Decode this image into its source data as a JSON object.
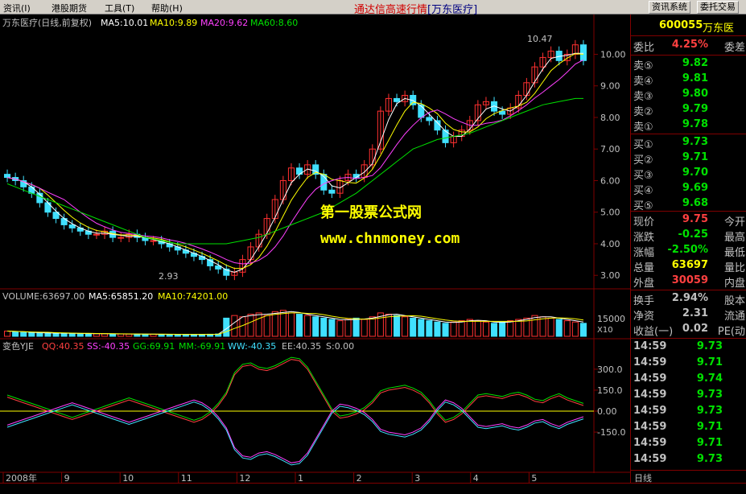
{
  "menu": {
    "items": [
      "资讯(I)",
      "港股期货",
      "工具(T)",
      "帮助(H)"
    ],
    "center_title": "通达信高速行情",
    "center_stock": "[万东医疗]",
    "buttons": [
      "资讯系统",
      "委托交易"
    ]
  },
  "main_header": {
    "title": "万东医疗(日线,前复权)",
    "ma5": "MA5:10.01",
    "ma10": "MA10:9.89",
    "ma20": "MA20:9.62",
    "ma60": "MA60:8.60"
  },
  "annotations": {
    "high_label": "10.47",
    "low_label": "2.93"
  },
  "volume_header": {
    "volume": "VOLUME:63697.00",
    "ma5": "MA5:65851.20",
    "ma10": "MA10:74201.00"
  },
  "indicator_header": {
    "name": "变色YJE",
    "qq": "QQ:40.35",
    "ss": "SS:-40.35",
    "gg": "GG:69.91",
    "mm": "MM:-69.91",
    "ww": "WW:-40.35",
    "ee": "EE:40.35",
    "s": "S:0.00"
  },
  "axes": {
    "price_ticks": [
      "10.00",
      "9.00",
      "8.00",
      "7.00",
      "6.00",
      "5.00",
      "4.00",
      "3.00"
    ],
    "volume_tick": "15000",
    "volume_unit": "X10",
    "indicator_ticks": [
      "300.0",
      "150.0",
      "0.00",
      "-150.0"
    ],
    "dates": [
      "2008年",
      "9",
      "10",
      "11",
      "12",
      "1",
      "2",
      "3",
      "4",
      "5"
    ]
  },
  "watermark": {
    "line1": "第一股票公式网",
    "line2": "www.chnmoney.com"
  },
  "quote": {
    "code": "600055",
    "name": "万东医",
    "weibi_label": "委比",
    "weibi": "4.25%",
    "weicha_label": "委差",
    "sell": [
      {
        "label": "卖⑤",
        "price": "9.82"
      },
      {
        "label": "卖④",
        "price": "9.81"
      },
      {
        "label": "卖③",
        "price": "9.80"
      },
      {
        "label": "卖②",
        "price": "9.79"
      },
      {
        "label": "卖①",
        "price": "9.78"
      }
    ],
    "buy": [
      {
        "label": "买①",
        "price": "9.73"
      },
      {
        "label": "买②",
        "price": "9.71"
      },
      {
        "label": "买③",
        "price": "9.70"
      },
      {
        "label": "买④",
        "price": "9.69"
      },
      {
        "label": "买⑤",
        "price": "9.68"
      }
    ],
    "stats": [
      {
        "label": "现价",
        "value": "9.75",
        "label2": "今开",
        "color": "#ff4040"
      },
      {
        "label": "涨跌",
        "value": "-0.25",
        "label2": "最高",
        "color": "#00e000"
      },
      {
        "label": "涨幅",
        "value": "-2.50%",
        "label2": "最低",
        "color": "#00e000"
      },
      {
        "label": "总量",
        "value": "63697",
        "label2": "量比",
        "color": "#ffff00"
      },
      {
        "label": "外盘",
        "value": "30059",
        "label2": "内盘",
        "color": "#ff4040"
      }
    ],
    "stats2": [
      {
        "label": "换手",
        "value": "2.94%",
        "label2": "股本",
        "color": "#c0c0c0"
      },
      {
        "label": "净资",
        "value": "2.31",
        "label2": "流通",
        "color": "#c0c0c0"
      },
      {
        "label": "收益(一)",
        "value": "0.02",
        "label2": "PE(动",
        "color": "#c0c0c0"
      }
    ],
    "ticks": [
      {
        "time": "14:59",
        "price": "9.73"
      },
      {
        "time": "14:59",
        "price": "9.71"
      },
      {
        "time": "14:59",
        "price": "9.74"
      },
      {
        "time": "14:59",
        "price": "9.73"
      },
      {
        "time": "14:59",
        "price": "9.73"
      },
      {
        "time": "14:59",
        "price": "9.71"
      },
      {
        "time": "14:59",
        "price": "9.71"
      },
      {
        "time": "14:59",
        "price": "9.73"
      }
    ],
    "bottom_tab": "日线"
  },
  "chart_data": {
    "type": "candlestick",
    "price_ylim": [
      2.7,
      10.7
    ],
    "close": [
      6.1,
      6.0,
      5.8,
      5.6,
      5.3,
      5.0,
      4.8,
      4.6,
      4.5,
      4.4,
      4.3,
      4.3,
      4.4,
      4.2,
      4.2,
      4.3,
      4.2,
      4.1,
      4.1,
      4.0,
      3.9,
      3.8,
      3.7,
      3.6,
      3.5,
      3.3,
      3.2,
      3.0,
      3.1,
      3.5,
      3.9,
      4.3,
      4.8,
      5.4,
      6.0,
      6.4,
      6.2,
      6.5,
      6.2,
      5.7,
      5.6,
      6.0,
      6.2,
      6.1,
      6.5,
      7.0,
      8.2,
      8.6,
      8.5,
      8.7,
      8.4,
      8.0,
      7.9,
      7.6,
      7.2,
      7.4,
      7.6,
      7.9,
      8.4,
      8.5,
      8.2,
      8.1,
      8.3,
      8.7,
      9.1,
      9.6,
      9.9,
      10.1,
      9.8,
      10.0,
      10.3,
      9.8
    ],
    "ma60": [
      5.9,
      5.8,
      5.7,
      5.6,
      5.5,
      5.4,
      5.3,
      5.2,
      5.1,
      5.0,
      4.9,
      4.8,
      4.7,
      4.6,
      4.5,
      4.4,
      4.3,
      4.2,
      4.15,
      4.1,
      4.05,
      4.0,
      4.0,
      4.0,
      4.0,
      4.0,
      4.0,
      4.0,
      4.05,
      4.1,
      4.15,
      4.2,
      4.3,
      4.4,
      4.5,
      4.6,
      4.7,
      4.8,
      4.9,
      5.0,
      5.15,
      5.3,
      5.45,
      5.6,
      5.8,
      6.0,
      6.2,
      6.4,
      6.6,
      6.8,
      7.0,
      7.1,
      7.2,
      7.3,
      7.35,
      7.4,
      7.45,
      7.5,
      7.6,
      7.7,
      7.8,
      7.9,
      8.0,
      8.1,
      8.2,
      8.3,
      8.4,
      8.45,
      8.5,
      8.55,
      8.6,
      8.6
    ],
    "volume_ylim": [
      0,
      26000
    ],
    "volume": [
      4000,
      3500,
      3000,
      2800,
      2500,
      2600,
      2400,
      2300,
      2200,
      2100,
      2000,
      2000,
      1900,
      1800,
      1800,
      1700,
      1700,
      1600,
      1600,
      1500,
      1500,
      1500,
      1400,
      1400,
      1500,
      1600,
      1800,
      14000,
      16000,
      15000,
      17000,
      18000,
      16000,
      19000,
      20000,
      18000,
      17000,
      16000,
      15000,
      14000,
      13000,
      12000,
      13000,
      14000,
      13000,
      15000,
      18000,
      17000,
      16000,
      15000,
      14000,
      13000,
      12000,
      11000,
      10000,
      11000,
      12000,
      13000,
      12000,
      11000,
      10000,
      11000,
      12000,
      13000,
      14000,
      16000,
      15000,
      14000,
      13000,
      12000,
      11000,
      10000
    ],
    "indicator_ylim": [
      -420,
      420
    ],
    "qq": [
      100,
      80,
      60,
      40,
      20,
      0,
      -20,
      -40,
      -60,
      -40,
      -20,
      0,
      20,
      40,
      60,
      80,
      60,
      40,
      20,
      0,
      -20,
      -40,
      -60,
      -80,
      -60,
      -20,
      40,
      120,
      260,
      320,
      330,
      300,
      290,
      310,
      340,
      370,
      360,
      300,
      200,
      100,
      0,
      -50,
      -40,
      -20,
      10,
      60,
      130,
      150,
      160,
      170,
      150,
      120,
      60,
      -20,
      -80,
      -60,
      -20,
      40,
      100,
      110,
      100,
      90,
      110,
      120,
      100,
      70,
      60,
      90,
      110,
      80,
      60,
      40
    ],
    "ss": [
      -100,
      -80,
      -60,
      -40,
      -20,
      0,
      20,
      40,
      60,
      40,
      20,
      0,
      -20,
      -40,
      -60,
      -80,
      -60,
      -40,
      -20,
      0,
      20,
      40,
      60,
      80,
      60,
      20,
      -40,
      -120,
      -260,
      -320,
      -330,
      -300,
      -290,
      -310,
      -340,
      -370,
      -360,
      -300,
      -200,
      -100,
      0,
      50,
      40,
      20,
      -10,
      -60,
      -130,
      -150,
      -160,
      -170,
      -150,
      -120,
      -60,
      20,
      80,
      60,
      20,
      -40,
      -100,
      -110,
      -100,
      -90,
      -110,
      -120,
      -100,
      -70,
      -60,
      -90,
      -110,
      -80,
      -60,
      -40
    ]
  }
}
